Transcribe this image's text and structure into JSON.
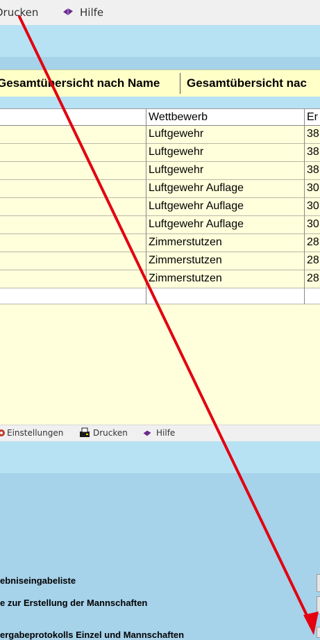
{
  "menubar": {
    "drucken_label": "Drucken",
    "hilfe_label": "Hilfe"
  },
  "tabs": [
    {
      "label": "Gesamtübersicht nach Name"
    },
    {
      "label": "Gesamtübersicht nac"
    }
  ],
  "grid": {
    "columns": [
      "Wettbewerb",
      "Er"
    ],
    "rows": [
      {
        "wettbewerb": "Luftgewehr",
        "er": "38"
      },
      {
        "wettbewerb": "Luftgewehr",
        "er": "38"
      },
      {
        "wettbewerb": "Luftgewehr",
        "er": "38"
      },
      {
        "wettbewerb": "Luftgewehr Auflage",
        "er": "30"
      },
      {
        "wettbewerb": "Luftgewehr Auflage",
        "er": "30"
      },
      {
        "wettbewerb": "Luftgewehr Auflage",
        "er": "30"
      },
      {
        "wettbewerb": "Zimmerstutzen",
        "er": "28"
      },
      {
        "wettbewerb": "Zimmerstutzen",
        "er": "28"
      },
      {
        "wettbewerb": "Zimmerstutzen",
        "er": "28"
      }
    ]
  },
  "toolbar2": {
    "einstellungen_label": "Einstellungen",
    "drucken_label": "Drucken",
    "hilfe_label": "Hilfe"
  },
  "options": [
    "ebniseingabeliste",
    "e zur Erstellung der Mannschaften",
    "ergabeprotokolls Einzel und Mannschaften"
  ],
  "colors": {
    "arrow": "#e3000f",
    "grid_bg": "#ffffdc",
    "tab_bg": "#ffffc8",
    "panel_bg": "#a6d2ea"
  }
}
